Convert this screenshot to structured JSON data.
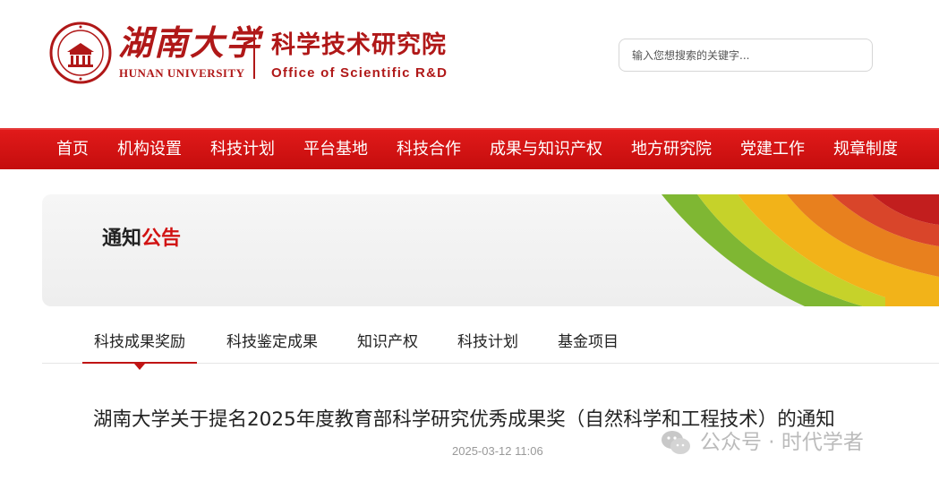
{
  "header": {
    "logo_cn": "湖南大学",
    "logo_en": "HUNAN UNIVERSITY",
    "office_cn": "科学技术研究院",
    "office_en": "Office of Scientific R&D",
    "search_placeholder": "输入您想搜索的关键字..."
  },
  "nav": {
    "items": [
      {
        "label": "首页"
      },
      {
        "label": "机构设置"
      },
      {
        "label": "科技计划"
      },
      {
        "label": "平台基地"
      },
      {
        "label": "科技合作"
      },
      {
        "label": "成果与知识产权"
      },
      {
        "label": "地方研究院"
      },
      {
        "label": "党建工作"
      },
      {
        "label": "规章制度"
      }
    ]
  },
  "banner": {
    "title_main": "通知",
    "title_accent": "公告"
  },
  "tabs": {
    "items": [
      {
        "label": "科技成果奖励",
        "active": true
      },
      {
        "label": "科技鉴定成果",
        "active": false
      },
      {
        "label": "知识产权",
        "active": false
      },
      {
        "label": "科技计划",
        "active": false
      },
      {
        "label": "基金项目",
        "active": false
      }
    ]
  },
  "article": {
    "title": "湖南大学关于提名2025年度教育部科学研究优秀成果奖（自然科学和工程技术）的通知",
    "date": "2025-03-12 11:06"
  },
  "watermark": {
    "text": "公众号 · 时代学者",
    "icon": "wechat-icon"
  },
  "colors": {
    "brand_red": "#c40d0d",
    "logo_red": "#b01818",
    "nav_text": "#ffffff",
    "muted": "#999999"
  }
}
